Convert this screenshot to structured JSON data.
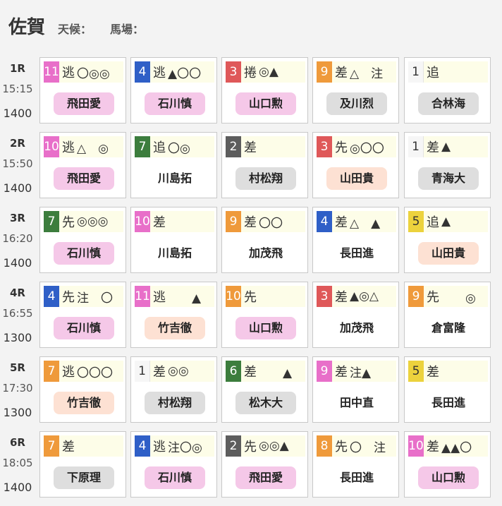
{
  "header": {
    "venue": "佐賀",
    "weather_label": "天候：",
    "track_label": "馬場："
  },
  "races": [
    {
      "race": "1R",
      "time": "15:15",
      "distance": "1400",
      "entries": [
        {
          "num": "11",
          "color": "pink",
          "style": "逃",
          "marks": "〇◎◎",
          "jockey": "飛田愛",
          "badge": "pink"
        },
        {
          "num": "4",
          "color": "blue",
          "style": "逃",
          "marks": "▲〇〇",
          "jockey": "石川慎",
          "badge": "pink"
        },
        {
          "num": "3",
          "color": "red",
          "style": "捲",
          "marks": "◎▲",
          "jockey": "山口勲",
          "badge": "pink"
        },
        {
          "num": "9",
          "color": "orange",
          "style": "差",
          "marks": "△　注",
          "jockey": "及川烈",
          "badge": "gray"
        },
        {
          "num": "1",
          "color": "white",
          "style": "追",
          "marks": "",
          "jockey": "合林海",
          "badge": "gray"
        }
      ]
    },
    {
      "race": "2R",
      "time": "15:50",
      "distance": "1400",
      "entries": [
        {
          "num": "10",
          "color": "pink",
          "style": "逃",
          "marks": "△　◎",
          "jockey": "飛田愛",
          "badge": "pink"
        },
        {
          "num": "7",
          "color": "green",
          "style": "追",
          "marks": "〇◎",
          "jockey": "川島拓",
          "badge": "none"
        },
        {
          "num": "2",
          "color": "gray",
          "style": "差",
          "marks": "",
          "jockey": "村松翔",
          "badge": "gray"
        },
        {
          "num": "3",
          "color": "red",
          "style": "先",
          "marks": "◎〇〇",
          "jockey": "山田貴",
          "badge": "peach"
        },
        {
          "num": "1",
          "color": "white",
          "style": "差",
          "marks": "▲",
          "jockey": "青海大",
          "badge": "gray"
        }
      ]
    },
    {
      "race": "3R",
      "time": "16:20",
      "distance": "1400",
      "entries": [
        {
          "num": "7",
          "color": "green",
          "style": "先",
          "marks": "◎◎◎",
          "jockey": "石川慎",
          "badge": "pink"
        },
        {
          "num": "10",
          "color": "pink",
          "style": "差",
          "marks": "",
          "jockey": "川島拓",
          "badge": "none"
        },
        {
          "num": "9",
          "color": "orange",
          "style": "差",
          "marks": "〇〇",
          "jockey": "加茂飛",
          "badge": "none"
        },
        {
          "num": "4",
          "color": "blue",
          "style": "差",
          "marks": "△　▲",
          "jockey": "長田進",
          "badge": "none"
        },
        {
          "num": "5",
          "color": "yellow",
          "style": "追",
          "marks": "▲",
          "jockey": "山田貴",
          "badge": "peach"
        }
      ]
    },
    {
      "race": "4R",
      "time": "16:55",
      "distance": "1300",
      "entries": [
        {
          "num": "4",
          "color": "blue",
          "style": "先",
          "marks": "注　〇",
          "jockey": "石川慎",
          "badge": "pink"
        },
        {
          "num": "11",
          "color": "pink",
          "style": "逃",
          "marks": "　　▲",
          "jockey": "竹吉徹",
          "badge": "peach"
        },
        {
          "num": "10",
          "color": "orange",
          "style": "先",
          "marks": "",
          "jockey": "山口勲",
          "badge": "pink"
        },
        {
          "num": "3",
          "color": "red",
          "style": "差",
          "marks": "▲◎△",
          "jockey": "加茂飛",
          "badge": "none"
        },
        {
          "num": "9",
          "color": "orange",
          "style": "先",
          "marks": "　　◎",
          "jockey": "倉富隆",
          "badge": "none"
        }
      ]
    },
    {
      "race": "5R",
      "time": "17:30",
      "distance": "1300",
      "entries": [
        {
          "num": "7",
          "color": "orange",
          "style": "逃",
          "marks": "〇〇〇",
          "jockey": "竹吉徹",
          "badge": "peach"
        },
        {
          "num": "1",
          "color": "white",
          "style": "差",
          "marks": "◎◎",
          "jockey": "村松翔",
          "badge": "gray"
        },
        {
          "num": "6",
          "color": "green",
          "style": "差",
          "marks": "　　▲",
          "jockey": "松木大",
          "badge": "gray"
        },
        {
          "num": "9",
          "color": "pink",
          "style": "差",
          "marks": "注▲",
          "jockey": "田中直",
          "badge": "none"
        },
        {
          "num": "5",
          "color": "yellow",
          "style": "差",
          "marks": "",
          "jockey": "長田進",
          "badge": "none"
        }
      ]
    },
    {
      "race": "6R",
      "time": "18:05",
      "distance": "1400",
      "entries": [
        {
          "num": "7",
          "color": "orange",
          "style": "差",
          "marks": "",
          "jockey": "下原理",
          "badge": "gray"
        },
        {
          "num": "4",
          "color": "blue",
          "style": "逃",
          "marks": "注〇◎",
          "jockey": "石川慎",
          "badge": "pink"
        },
        {
          "num": "2",
          "color": "gray",
          "style": "先",
          "marks": "◎◎▲",
          "jockey": "飛田愛",
          "badge": "pink"
        },
        {
          "num": "8",
          "color": "orange",
          "style": "先",
          "marks": "〇　注",
          "jockey": "長田進",
          "badge": "none"
        },
        {
          "num": "10",
          "color": "pink",
          "style": "差",
          "marks": "▲▲〇",
          "jockey": "山口勲",
          "badge": "pink"
        }
      ]
    }
  ]
}
